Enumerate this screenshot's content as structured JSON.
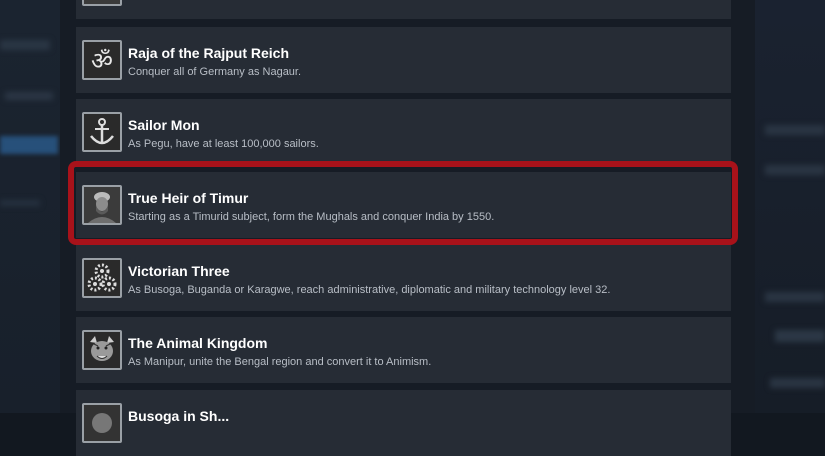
{
  "achievements": [
    {
      "title": "",
      "description": "",
      "icon": "partial-achievement-icon"
    },
    {
      "title": "Raja of the Rajput Reich",
      "description": "Conquer all of Germany as Nagaur.",
      "icon": "om-symbol-icon"
    },
    {
      "title": "Sailor Mon",
      "description": "As Pegu, have at least 100,000 sailors.",
      "icon": "anchor-icon"
    },
    {
      "title": "True Heir of Timur",
      "description": "Starting as a Timurid subject, form the Mughals and conquer India by 1550.",
      "icon": "timur-portrait-icon"
    },
    {
      "title": "Victorian Three",
      "description": "As Busoga, Buganda or Karagwe, reach administrative, diplomatic and military technology level 32.",
      "icon": "gears-icon"
    },
    {
      "title": "The Animal Kingdom",
      "description": "As Manipur, unite the Bengal region and convert it to Animism.",
      "icon": "tiger-head-icon"
    },
    {
      "title": "Busoga in Sh...",
      "description": "",
      "icon": "partial-achievement-icon"
    }
  ],
  "colors": {
    "highlight": "#a8121a",
    "row_background": "#262c35",
    "title": "#ffffff",
    "description": "#b8bec6"
  }
}
